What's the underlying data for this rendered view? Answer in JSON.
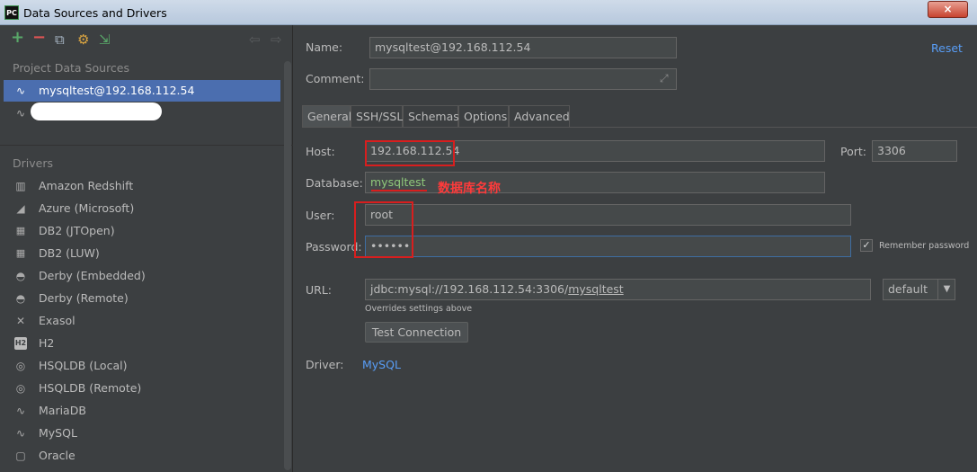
{
  "window": {
    "app_icon": "PC",
    "title": "Data Sources and Drivers",
    "close_glyph": "×"
  },
  "sidebar": {
    "toolbar": {
      "add_glyph": "+",
      "remove_glyph": "−",
      "copy_glyph": "⧉",
      "settings_glyph": "⚙",
      "import_glyph": "⇲",
      "back_glyph": "⇦",
      "forward_glyph": "⇨"
    },
    "project_sources_label": "Project Data Sources",
    "project_sources": [
      {
        "label": "mysqltest@192.168.112.54",
        "icon": "mysql-icon"
      },
      {
        "label": "",
        "icon": "mysql-icon"
      }
    ],
    "drivers_label": "Drivers",
    "drivers": [
      {
        "label": "Amazon Redshift",
        "icon": "redshift-icon",
        "glyph": "▥"
      },
      {
        "label": "Azure (Microsoft)",
        "icon": "azure-icon",
        "glyph": "◢"
      },
      {
        "label": "DB2 (JTOpen)",
        "icon": "ibm-db2-icon",
        "glyph": "▦"
      },
      {
        "label": "DB2 (LUW)",
        "icon": "ibm-db2-icon",
        "glyph": "▦"
      },
      {
        "label": "Derby (Embedded)",
        "icon": "derby-hat-icon",
        "glyph": "◓"
      },
      {
        "label": "Derby (Remote)",
        "icon": "derby-hat-icon",
        "glyph": "◓"
      },
      {
        "label": "Exasol",
        "icon": "exasol-icon",
        "glyph": "✕"
      },
      {
        "label": "H2",
        "icon": "h2-icon",
        "glyph": "H2"
      },
      {
        "label": "HSQLDB (Local)",
        "icon": "hsqldb-icon",
        "glyph": "◎"
      },
      {
        "label": "HSQLDB (Remote)",
        "icon": "hsqldb-icon",
        "glyph": "◎"
      },
      {
        "label": "MariaDB",
        "icon": "mariadb-icon",
        "glyph": "∿"
      },
      {
        "label": "MySQL",
        "icon": "mysql-icon",
        "glyph": "∿"
      },
      {
        "label": "Oracle",
        "icon": "oracle-icon",
        "glyph": "▢"
      }
    ]
  },
  "form": {
    "name_label": "Name:",
    "name_value": "mysqltest@192.168.112.54",
    "reset_label": "Reset",
    "comment_label": "Comment:",
    "comment_value": "",
    "expand_glyph": "⤢",
    "tabs": [
      "General",
      "SSH/SSL",
      "Schemas",
      "Options",
      "Advanced"
    ],
    "host_label": "Host:",
    "host_value": "192.168.112.54",
    "port_label": "Port:",
    "port_value": "3306",
    "database_label": "Database:",
    "database_value": "mysqltest",
    "database_annotation": "数据库名称",
    "user_label": "User:",
    "user_value": "root",
    "password_label": "Password:",
    "password_value": "••••••",
    "remember_password_label": "Remember password",
    "remember_password_checked": true,
    "check_glyph": "✓",
    "url_label": "URL:",
    "url_prefix": "jdbc:mysql://192.168.112.54:3306/",
    "url_db": "mysqltest",
    "url_mode": "default",
    "dropdown_glyph": "▼",
    "overrides_note": "Overrides settings above",
    "test_connection_label": "Test Connection",
    "driver_label": "Driver:",
    "driver_value": "MySQL"
  },
  "colors": {
    "selection": "#4b6eaf",
    "link": "#589df6",
    "annotation_red": "#d81e1e",
    "add_green": "#59a869",
    "remove_red": "#e05555"
  }
}
